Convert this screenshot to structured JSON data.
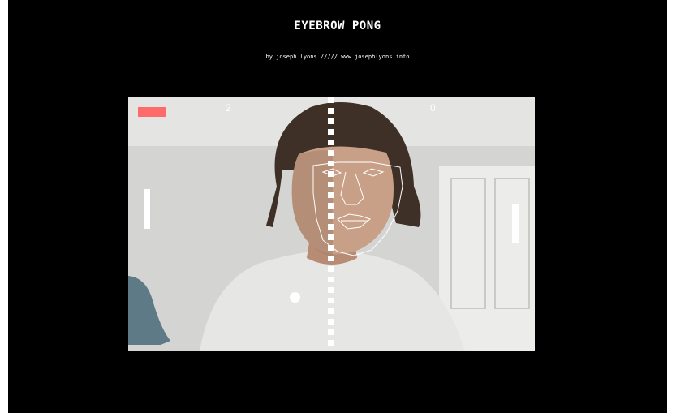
{
  "header": {
    "title": "EYEBROW PONG",
    "byline": "by joseph lyons ///// www.josephlyons.info"
  },
  "game": {
    "score_left": "2",
    "score_right": "0",
    "indicator_color": "#ff6b6b",
    "ball_color": "#ffffff",
    "paddle_color": "#ffffff",
    "net_style": "dashed"
  },
  "colors": {
    "background": "#000000",
    "text": "#ffffff",
    "face_mesh": "#ffffff"
  }
}
